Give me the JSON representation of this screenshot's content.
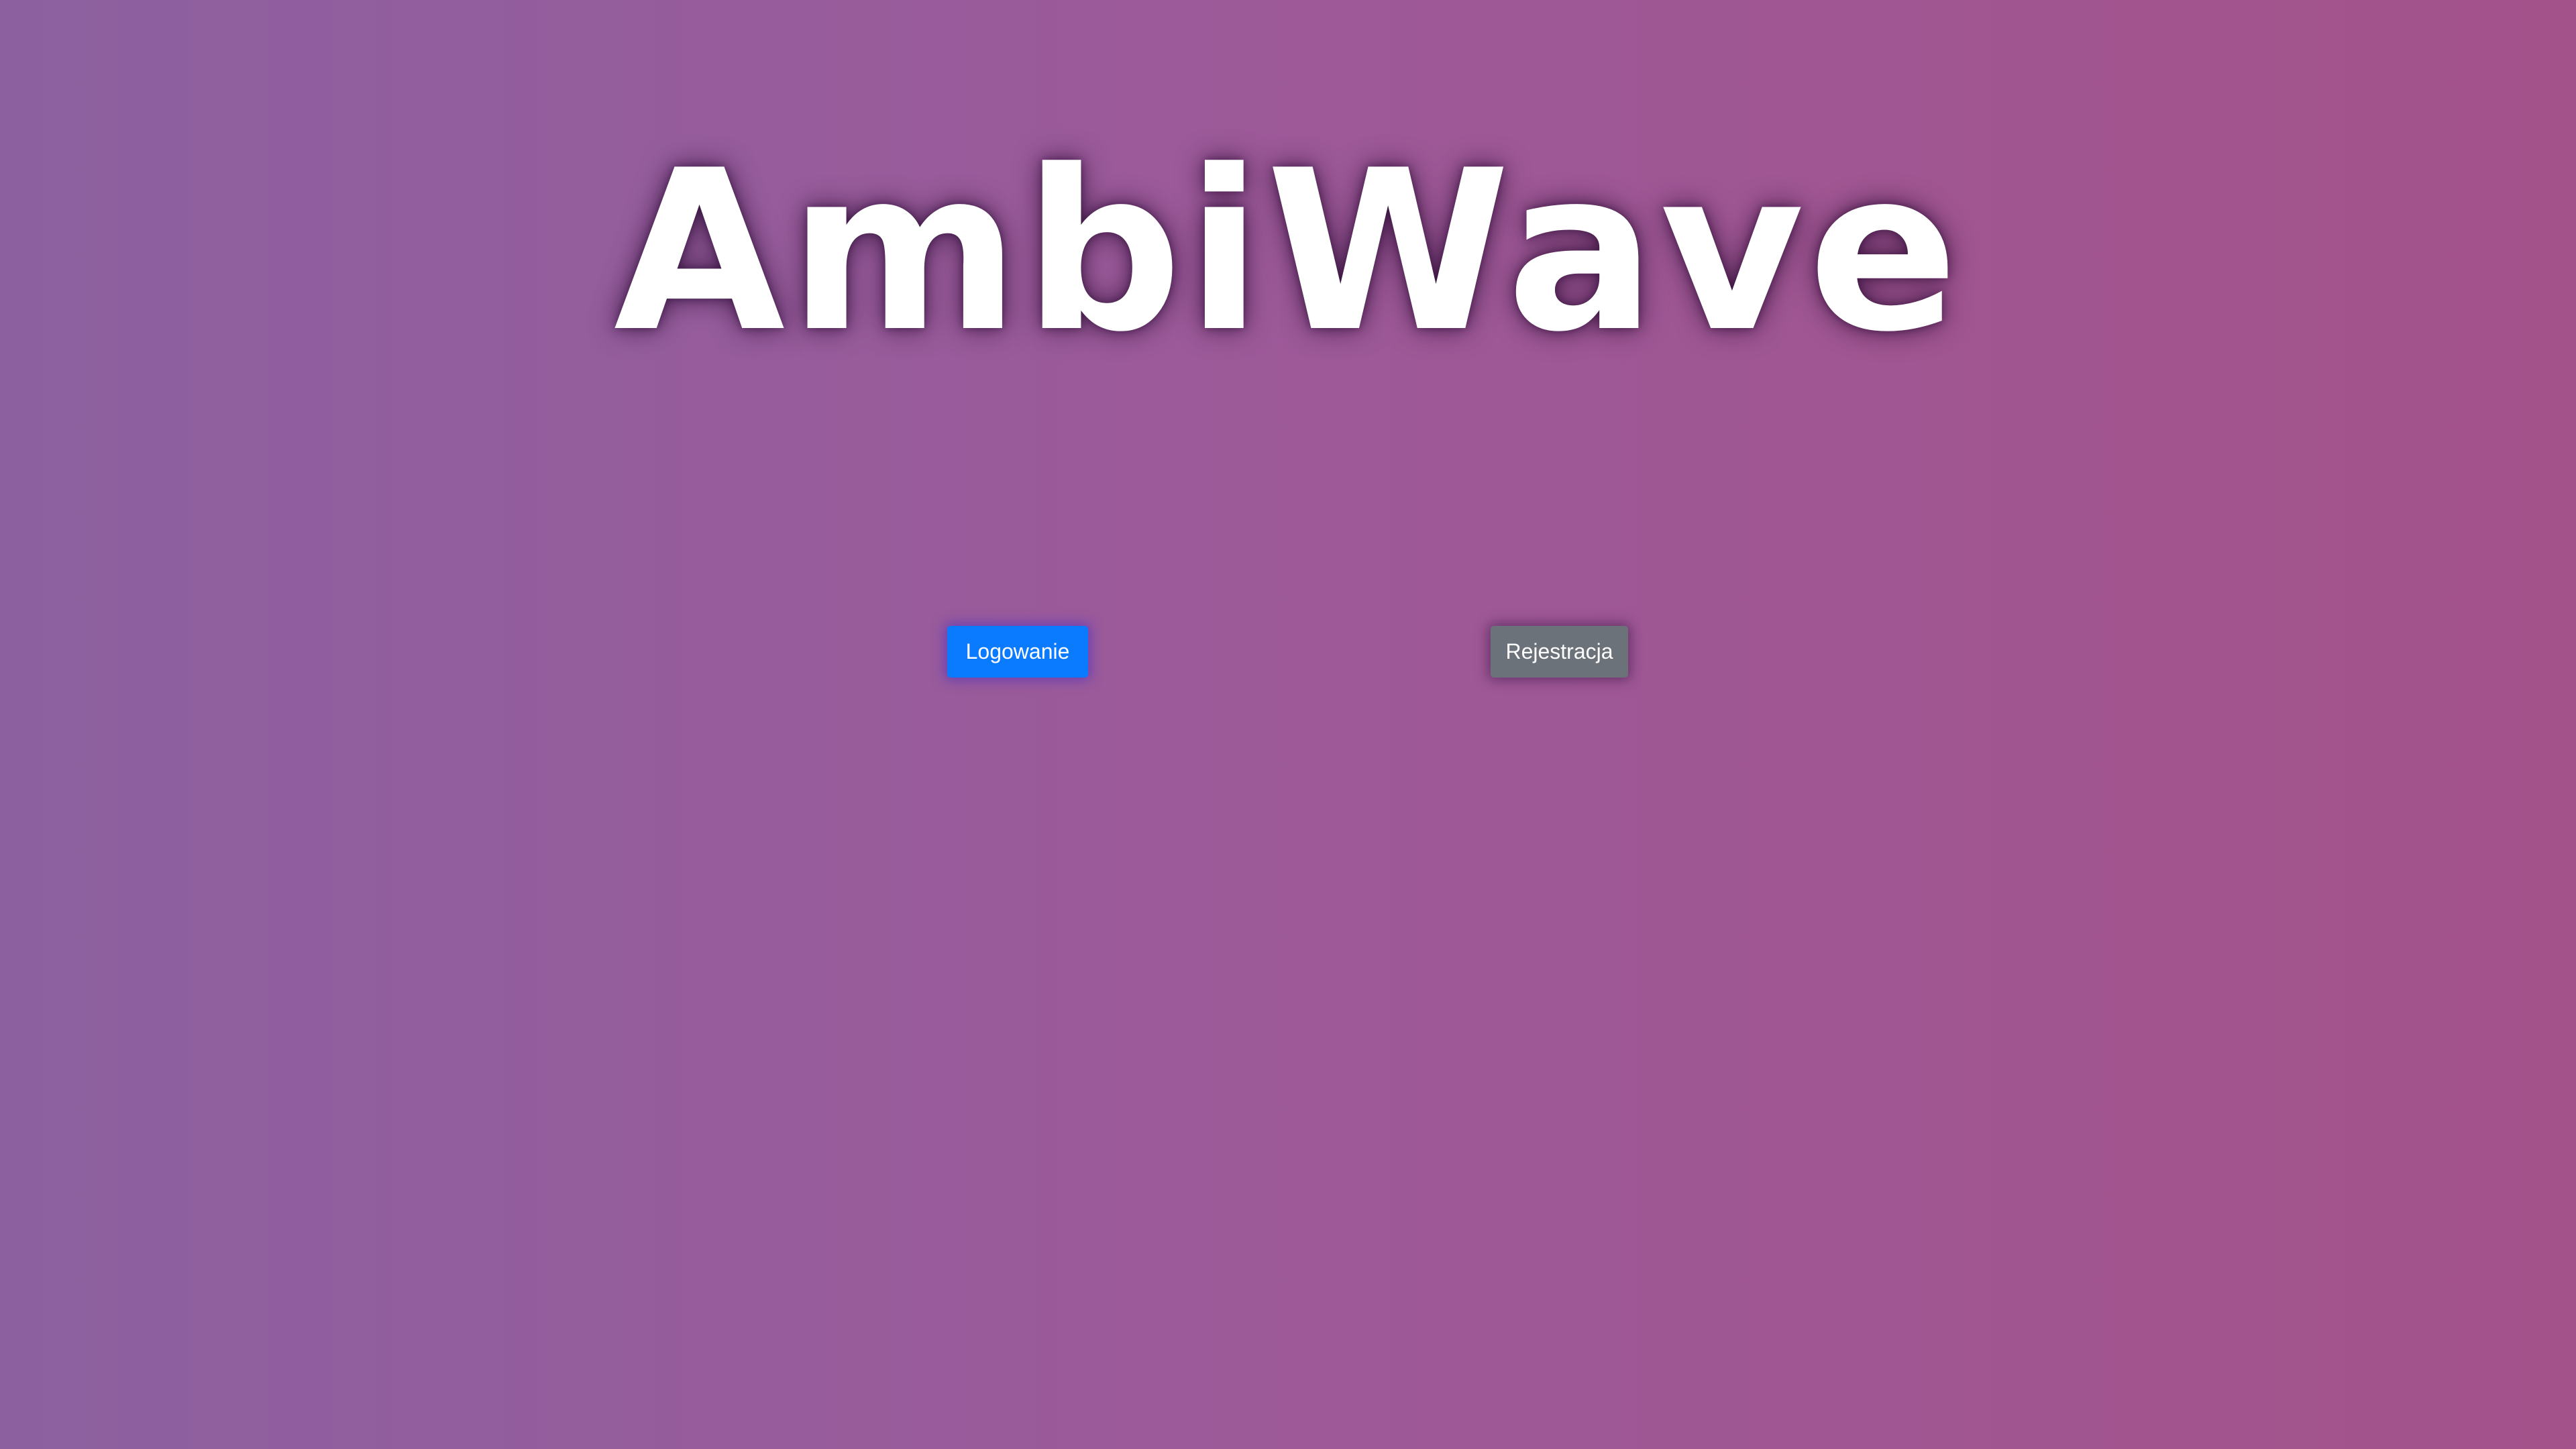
{
  "header": {
    "logo_text": "AmbiWave"
  },
  "actions": {
    "login_label": "Logowanie",
    "register_label": "Rejestracja"
  },
  "colors": {
    "background_start": "#8c609f",
    "background_end": "#a4528a",
    "login_button": "#0a7bff",
    "register_button": "#6c727a",
    "logo_text": "#ffffff"
  }
}
